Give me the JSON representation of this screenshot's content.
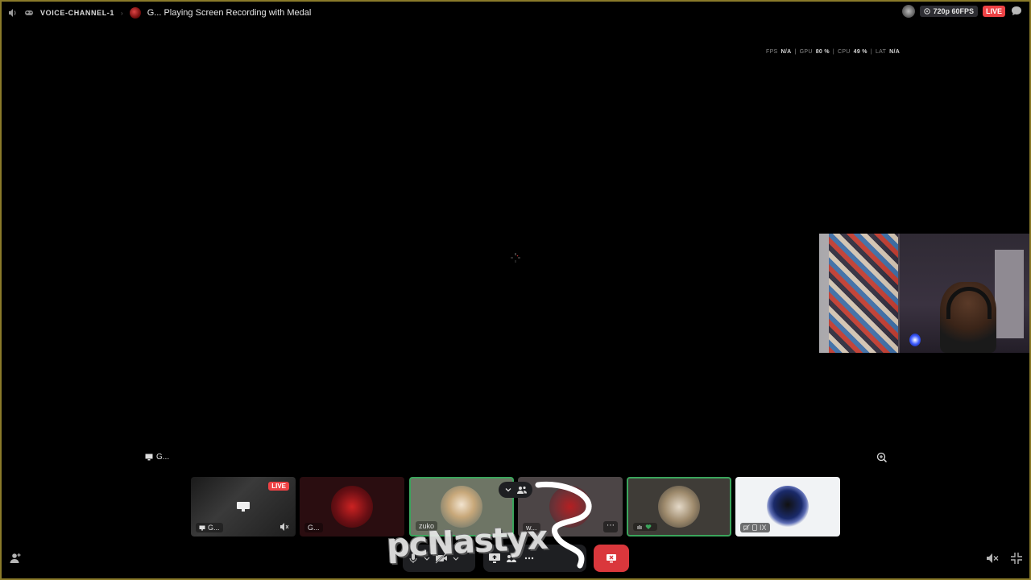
{
  "topbar": {
    "channel_name": "VOICE-CHANNEL-1",
    "stream_title": "G... Playing Screen Recording with Medal",
    "quality": "720p 60FPS",
    "live_badge": "LIVE"
  },
  "stats": {
    "fps_label": "FPS",
    "fps_value": "N/A",
    "gpu_label": "GPU",
    "gpu_value": "80 %",
    "cpu_label": "CPU",
    "cpu_value": "49 %",
    "lat_label": "LAT",
    "lat_value": "N/A"
  },
  "screen_label": "G...",
  "tiles": [
    {
      "name": "G...",
      "badge": "LIVE"
    },
    {
      "name": "G..."
    },
    {
      "name": "zuko"
    },
    {
      "name": "w..."
    },
    {
      "name": ""
    },
    {
      "name": "IX"
    }
  ],
  "watermark": "pcNastyx",
  "icons": {
    "speaker": "speaker-icon",
    "controller": "gamepad-icon",
    "chat": "chat-bubble-icon",
    "zoom": "zoom-in-icon",
    "add_user": "add-user-icon",
    "volume_off": "volume-mute-icon",
    "minimize": "minimize-icon"
  },
  "colors": {
    "live_red": "#ed4245",
    "speaking_green": "#3ba55c",
    "leave_red": "#da373c"
  }
}
